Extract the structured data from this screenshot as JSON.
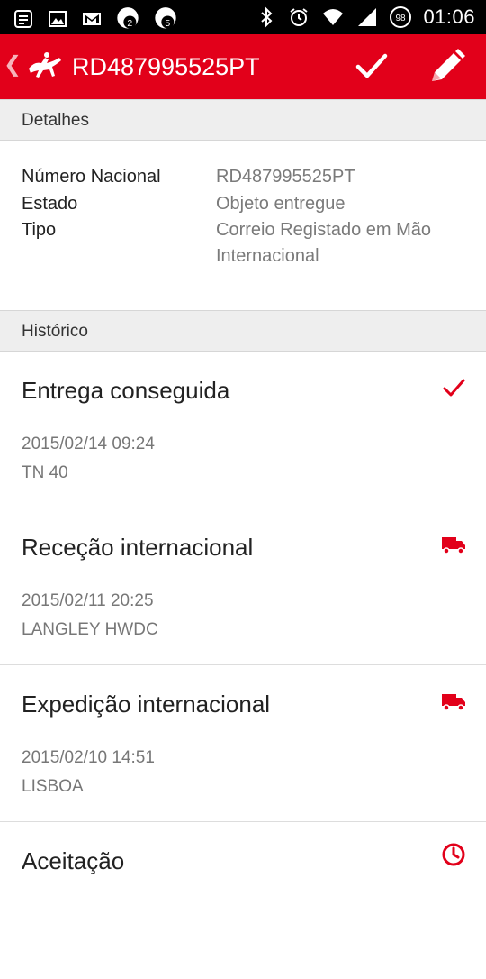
{
  "status_bar": {
    "time": "01:06",
    "notification_badges": [
      "2",
      "5"
    ],
    "battery": "98"
  },
  "app_bar": {
    "title": "RD487995525PT",
    "back_glyph": "❮"
  },
  "details": {
    "header": "Detalhes",
    "rows": [
      {
        "label": "Número Nacional",
        "value": "RD487995525PT"
      },
      {
        "label": "Estado",
        "value": "Objeto entregue"
      },
      {
        "label": "Tipo",
        "value": "Correio Registado em Mão Internacional"
      }
    ]
  },
  "history": {
    "header": "Histórico",
    "items": [
      {
        "title": "Entrega conseguida",
        "date": "2015/02/14 09:24",
        "place": "TN 40",
        "icon": "check-icon"
      },
      {
        "title": "Receção internacional",
        "date": "2015/02/11 20:25",
        "place": "LANGLEY HWDC",
        "icon": "truck-icon"
      },
      {
        "title": "Expedição internacional",
        "date": "2015/02/10 14:51",
        "place": "LISBOA",
        "icon": "truck-icon"
      },
      {
        "title": "Aceitação",
        "date": "",
        "place": "",
        "icon": "clock-icon"
      }
    ]
  },
  "colors": {
    "brand_red": "#e2001a",
    "header_gray": "#eeeeee",
    "secondary_text": "#777777"
  }
}
